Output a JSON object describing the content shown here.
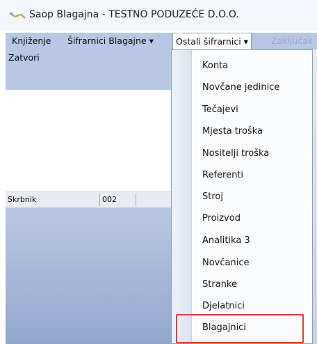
{
  "window": {
    "title": "Saop Blagajna - TESTNO PODUZEĆE D.O.O."
  },
  "menubar": {
    "items": [
      {
        "label": "Knjiženje"
      },
      {
        "label": "Šifrarnici Blagajne ▾"
      },
      {
        "label": "Ostali šifrarnici ▾"
      },
      {
        "label": "Zaključak"
      }
    ]
  },
  "toolbar": {
    "zatvori": "Zatvori"
  },
  "statusbar": {
    "cells": [
      "Skrbnik",
      "002",
      ""
    ]
  },
  "dropdown": {
    "items": [
      {
        "label": "Konta"
      },
      {
        "label": "Novčane jedinice"
      },
      {
        "label": "Tečajevi"
      },
      {
        "label": "Mjesta troška"
      },
      {
        "label": "Nositelji troška"
      },
      {
        "label": "Referenti"
      },
      {
        "label": "Stroj"
      },
      {
        "label": "Proizvod"
      },
      {
        "label": "Analitika 3"
      },
      {
        "label": "Novčanice"
      },
      {
        "label": "Stranke"
      },
      {
        "label": "Djelatnici"
      },
      {
        "label": "Blagajnici"
      }
    ]
  },
  "colors": {
    "menubar_bg": "#b6c8e4",
    "highlight_border": "#d9403a"
  },
  "icons": {
    "app": "saop-app-icon"
  }
}
